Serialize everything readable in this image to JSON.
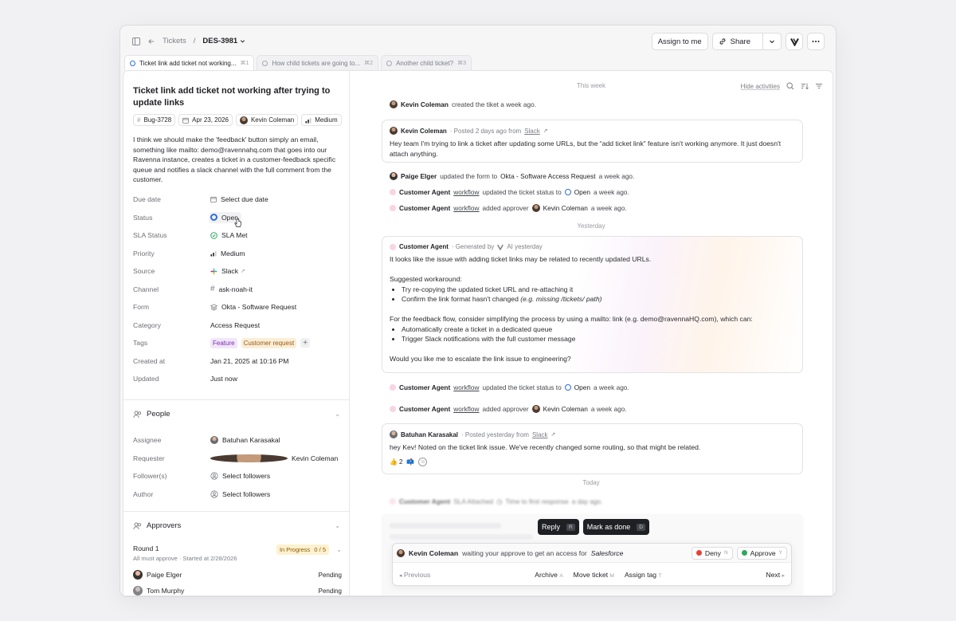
{
  "header": {
    "crumb_parent": "Tickets",
    "crumb_sep": "/",
    "crumb_id": "DES-3981",
    "assign_label": "Assign to me",
    "share_label": "Share"
  },
  "tabs": [
    {
      "label": "Ticket link add ticket not working...",
      "kbd": "⌘1"
    },
    {
      "label": "How child tickets are going to...",
      "kbd": "⌘2"
    },
    {
      "label": "Another child ticket?",
      "kbd": "⌘3"
    }
  ],
  "ticket": {
    "title": "Ticket link add ticket not working after trying to update links",
    "chips": {
      "bug": "Bug-3728",
      "date": "Apr 23, 2026",
      "owner": "Kevin Coleman",
      "priority": "Medium"
    },
    "description": "I think we should make the 'feedback' button simply an email, something like mailto: demo@ravennahq.com that goes into our Ravenna instance, creates a ticket in a customer-feedback specific queue and notifies a slack channel with the full comment from the customer."
  },
  "props": {
    "due_k": "Due date",
    "due_v": "Select due date",
    "status_k": "Status",
    "status_v": "Open",
    "sla_k": "SLA Status",
    "sla_v": "SLA Met",
    "priority_k": "Priority",
    "priority_v": "Medium",
    "source_k": "Source",
    "source_v": "Slack",
    "channel_k": "Channel",
    "channel_v": "ask-noah-it",
    "form_k": "Form",
    "form_v": "Okta - Software Request",
    "category_k": "Category",
    "category_v": "Access Request",
    "tags_k": "Tags",
    "tag1": "Feature",
    "tag2": "Customer request",
    "created_k": "Created at",
    "created_v": "Jan 21, 2025 at 10:16 PM",
    "updated_k": "Updated",
    "updated_v": "Just now"
  },
  "people": {
    "title": "People",
    "assignee_k": "Assignee",
    "assignee_v": "Batuhan Karasakal",
    "requester_k": "Requester",
    "requester_v": "Kevin Coleman",
    "followers_k": "Follower(s)",
    "followers_v": "Select followers",
    "author_k": "Author",
    "author_v": "Select followers"
  },
  "approvers": {
    "title": "Approvers",
    "round_title": "Round 1",
    "round_sub": "All must approve · Started at 2/28/2026",
    "round_status": "In Progress",
    "round_count": "0 / 5",
    "list": [
      {
        "name": "Paige Elger",
        "status": "Pending"
      },
      {
        "name": "Tom Murphy",
        "status": "Pending"
      }
    ]
  },
  "feed": {
    "this_week": "This week",
    "hide_activities": "Hide activities",
    "yesterday": "Yesterday",
    "today": "Today",
    "ev1": {
      "actor": "Kevin Coleman",
      "text": "created the tiket a week ago."
    },
    "msg1": {
      "author": "Kevin Coleman",
      "meta": "· Posted 2 days ago from",
      "source": "Slack",
      "body": "Hey team I'm trying to link a ticket after updating some URLs, but the “add ticket link” feature isn't working anymore. It just doesn't attach anything."
    },
    "ev2": {
      "actor": "Paige Elger",
      "mid": "updated the form to",
      "obj": "Okta - Software Access Request",
      "tail": "a week ago."
    },
    "ev3": {
      "actor": "Customer Agent",
      "via": "workflow",
      "mid": "updated the ticket status to",
      "obj": "Open",
      "tail": "a week ago."
    },
    "ev4": {
      "actor": "Customer Agent",
      "via": "workflow",
      "mid": "added approver",
      "obj": "Kevin Coleman",
      "tail": "a week ago."
    },
    "ai": {
      "author": "Customer Agent",
      "meta": "· Generated by",
      "meta2": "AI yesterday",
      "p1": "It looks like the issue with adding ticket links may be related to recently updated URLs.",
      "p2": "Suggested workaround:",
      "b1": "Try re-copying the updated ticket URL and re-attaching it",
      "b2": "Confirm the link format hasn't changed",
      "b2i": "(e.g. missing /tickets/ path)",
      "p3": "For the feedback flow, consider simplifying the process by using a mailto: link (e.g. demo@ravennaHQ.com), which can:",
      "b3": "Automatically create a ticket in a dedicated queue",
      "b4": "Trigger Slack notifications with the full customer message",
      "p4": "Would you like me to escalate the link issue to engineering?"
    },
    "ev5": {
      "actor": "Customer Agent",
      "via": "workflow",
      "mid": "updated the ticket status to",
      "obj": "Open",
      "tail": "a week ago."
    },
    "ev6": {
      "actor": "Customer Agent",
      "via": "workflow",
      "mid": "added approver",
      "obj": "Kevin Coleman",
      "tail": "a week ago."
    },
    "msg2": {
      "author": "Batuhan Karasakal",
      "meta": "· Posted yesterday from",
      "source": "Slack",
      "body": "hey Kev! Noted on the ticket link issue. We've recently changed some routing, so that might be related.",
      "react_count": "2"
    },
    "ev7": {
      "actor": "Customer Agent",
      "mid": "SLA Attached",
      "obj": "Time to first response",
      "tail": "a day ago."
    }
  },
  "actions": {
    "reply": "Reply",
    "reply_k": "R",
    "done": "Mark as done",
    "done_k": "D"
  },
  "approval": {
    "actor": "Kevin Coleman",
    "text": "waiting your approve to get an access for",
    "target": "Salesforce",
    "deny": "Deny",
    "deny_k": "N",
    "approve": "Approve",
    "approve_k": "Y",
    "previous": "Previous",
    "archive": "Archive",
    "archive_k": "A",
    "move": "Move ticket",
    "move_k": "M",
    "assign_tag": "Assign tag",
    "assign_tag_k": "T",
    "next": "Next"
  }
}
